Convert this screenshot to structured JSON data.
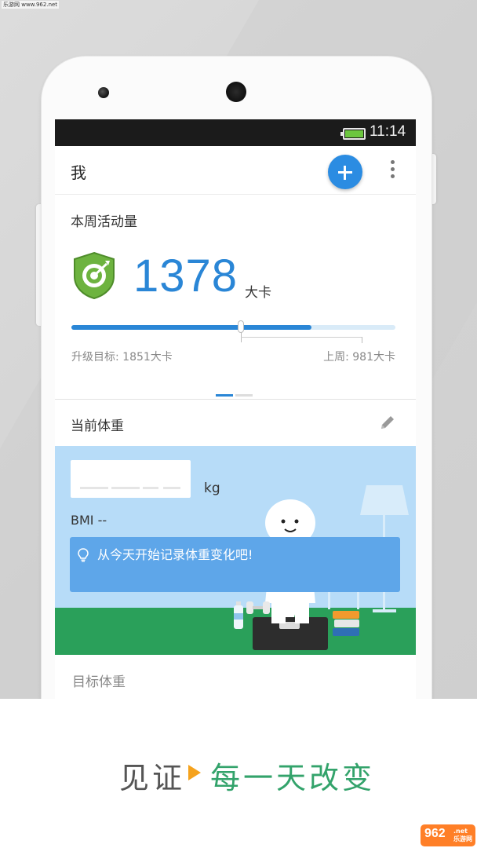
{
  "watermark_top": "乐游网 www.962.net",
  "status_bar": {
    "time": "11:14",
    "battery_color": "#6cc63f"
  },
  "app_bar": {
    "title": "我",
    "add_icon": "plus-icon",
    "menu_icon": "more-vert-icon",
    "accent": "#2b8ce2"
  },
  "activity_card": {
    "title": "本周活动量",
    "badge_icon": "target-shield-icon",
    "calories": "1378",
    "unit": "大卡",
    "progress": 0.74,
    "progress_color": "#2a86d6",
    "target_label": "升级目标: 1851大卡",
    "last_week_label": "上周: 981大卡",
    "pager": {
      "pages": 2,
      "active": 1
    }
  },
  "weight_card": {
    "title": "当前体重",
    "edit_icon": "pencil-icon",
    "unit": "kg",
    "bmi": "BMI --",
    "tip_icon": "lightbulb-icon",
    "tip": "从今天开始记录体重变化吧!"
  },
  "next_section": {
    "title": "目标体重"
  },
  "slogan": {
    "left": "见证",
    "right": "每一天改变",
    "arrow_color": "#f5a21d",
    "right_color": "#33a36b"
  },
  "watermark_bottom": {
    "number": "962",
    "text": ".net乐游网"
  }
}
